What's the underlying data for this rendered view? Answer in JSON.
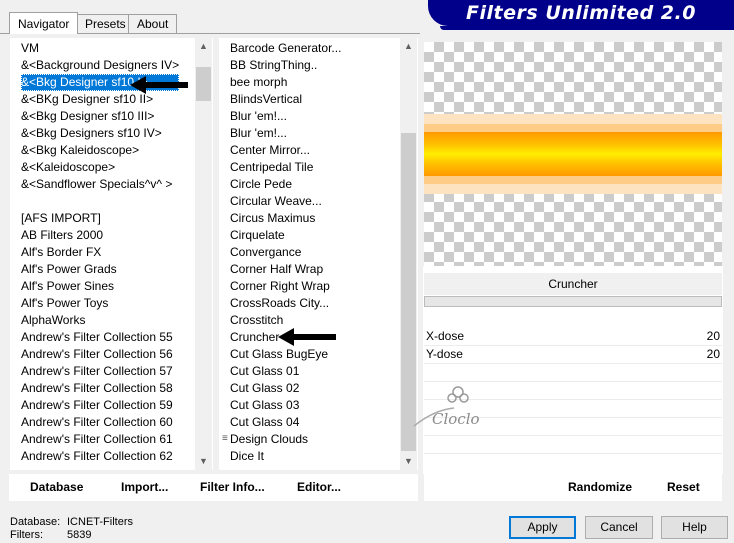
{
  "tabs": [
    {
      "label": "Navigator",
      "active": true
    },
    {
      "label": "Presets",
      "active": false
    },
    {
      "label": "About",
      "active": false
    }
  ],
  "banner": {
    "title": "Filters Unlimited 2.0",
    "color": "#00008b"
  },
  "categories": [
    "VM",
    "&<Background Designers IV>",
    "&<Bkg Designer sf10 I>",
    "&<BKg Designer sf10 II>",
    "&<Bkg Designer sf10 III>",
    "&<Bkg Designers sf10 IV>",
    "&<Bkg Kaleidoscope>",
    "&<Kaleidoscope>",
    "&<Sandflower Specials^v^ >",
    "",
    "[AFS IMPORT]",
    "AB Filters 2000",
    "Alf's Border FX",
    "Alf's Power Grads",
    "Alf's Power Sines",
    "Alf's Power Toys",
    "AlphaWorks",
    "Andrew's Filter Collection 55",
    "Andrew's Filter Collection 56",
    "Andrew's Filter Collection 57",
    "Andrew's Filter Collection 58",
    "Andrew's Filter Collection 59",
    "Andrew's Filter Collection 60",
    "Andrew's Filter Collection 61",
    "Andrew's Filter Collection 62"
  ],
  "selected_category_index": 2,
  "filters": [
    "Barcode Generator...",
    "BB StringThing..",
    "bee morph",
    "BlindsVertical",
    "Blur 'em!...",
    "Blur 'em!...",
    "Center Mirror...",
    "Centripedal Tile",
    "Circle Pede",
    "Circular Weave...",
    "Circus Maximus",
    "Cirquelate",
    "Convergance",
    "Corner Half Wrap",
    "Corner Right Wrap",
    "CrossRoads City...",
    "Crosstitch",
    "Cruncher",
    "Cut Glass  BugEye",
    "Cut Glass 01",
    "Cut Glass 02",
    "Cut Glass 03",
    "Cut Glass 04",
    "Design Clouds",
    "Dice It"
  ],
  "selected_filter": "Cruncher",
  "params": [
    {
      "label": "X-dose",
      "value": "20"
    },
    {
      "label": "Y-dose",
      "value": "20"
    }
  ],
  "watermark": "Cloclo",
  "toolbar": {
    "database": "Database",
    "import": "Import...",
    "filter_info": "Filter Info...",
    "editor": "Editor...",
    "randomize": "Randomize",
    "reset": "Reset"
  },
  "buttons": {
    "apply": "Apply",
    "cancel": "Cancel",
    "help": "Help"
  },
  "status": {
    "database_label": "Database:",
    "database_value": "ICNET-Filters",
    "filters_label": "Filters:",
    "filters_value": "5839"
  },
  "colors": {
    "selection": "#0078d7",
    "accent_orange": "#ff9900",
    "accent_yellow": "#ffee00"
  }
}
